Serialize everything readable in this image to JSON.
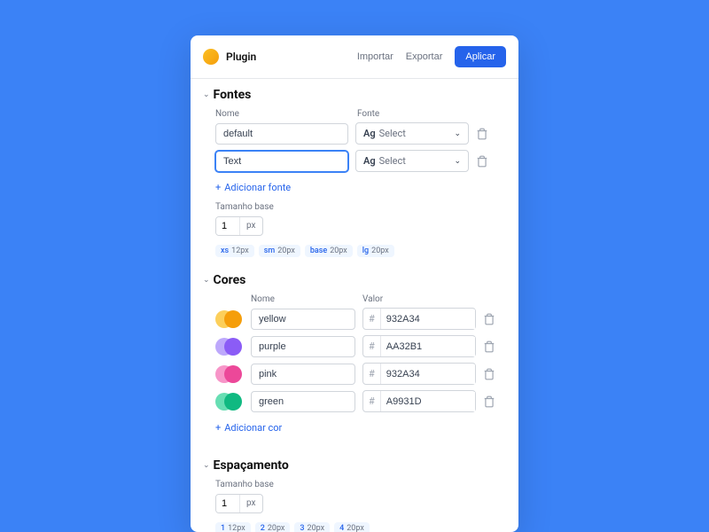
{
  "app": {
    "name": "Plugin"
  },
  "header": {
    "import": "Importar",
    "export": "Exportar",
    "apply": "Aplicar"
  },
  "fonts": {
    "title": "Fontes",
    "name_label": "Nome",
    "font_label": "Fonte",
    "rows": [
      {
        "name": "default",
        "select_prefix": "Ag",
        "select_placeholder": "Select"
      },
      {
        "name": "Text",
        "select_prefix": "Ag",
        "select_placeholder": "Select"
      }
    ],
    "add": "Adicionar fonte",
    "base_label": "Tamanho base",
    "base_value": "1",
    "base_unit": "px",
    "scale": [
      {
        "k": "xs",
        "v": "12px"
      },
      {
        "k": "sm",
        "v": "20px"
      },
      {
        "k": "base",
        "v": "20px"
      },
      {
        "k": "lg",
        "v": "20px"
      }
    ]
  },
  "colors": {
    "title": "Cores",
    "name_label": "Nome",
    "value_label": "Valor",
    "rows": [
      {
        "name": "yellow",
        "hex": "932A34",
        "c1": "#fbbf24",
        "c2": "#f59e0b"
      },
      {
        "name": "purple",
        "hex": "AA32B1",
        "c1": "#a78bfa",
        "c2": "#8b5cf6"
      },
      {
        "name": "pink",
        "hex": "932A34",
        "c1": "#f472b6",
        "c2": "#ec4899"
      },
      {
        "name": "green",
        "hex": "A9931D",
        "c1": "#34d399",
        "c2": "#10b981"
      }
    ],
    "add": "Adicionar cor"
  },
  "spacing": {
    "title": "Espaçamento",
    "base_label": "Tamanho base",
    "base_value": "1",
    "base_unit": "px",
    "scale": [
      {
        "k": "1",
        "v": "12px"
      },
      {
        "k": "2",
        "v": "20px"
      },
      {
        "k": "3",
        "v": "20px"
      },
      {
        "k": "4",
        "v": "20px"
      }
    ]
  }
}
